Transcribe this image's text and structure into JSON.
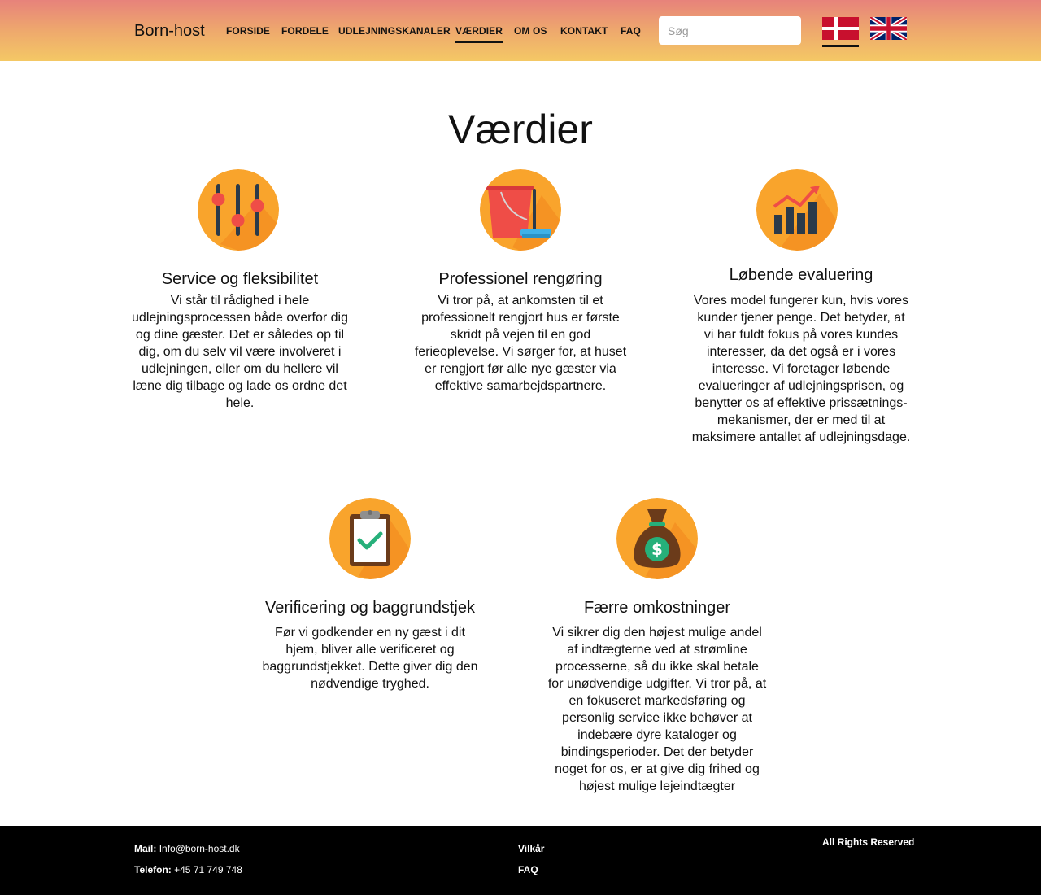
{
  "header": {
    "logo": "Born-host",
    "nav": [
      "FORSIDE",
      "FORDELE",
      "UDLEJNINGSKANALER",
      "VÆRDIER",
      "OM OS",
      "KONTAKT",
      "FAQ"
    ],
    "active_nav": "VÆRDIER",
    "search_placeholder": "Søg",
    "flags": [
      "danish-flag-icon",
      "uk-flag-icon"
    ],
    "active_language": "danish"
  },
  "main": {
    "title": "Værdier",
    "cards": [
      {
        "icon": "sliders-icon",
        "title": "Service og fleksibilitet",
        "text": "Vi står til rådighed i hele udlejningsprocessen både overfor dig og dine gæster. Det er således op til dig, om du selv vil være involveret i udlejningen, eller om du hellere vil læne dig tilbage og lade os ordne det hele."
      },
      {
        "icon": "bucket-mop-icon",
        "title": "Professionel rengøring",
        "text": "Vi tror på, at ankomsten til et professionelt rengjort hus er første skridt på vejen til en god ferieoplevelse. Vi sørger for, at huset er rengjort før alle nye gæster via effektive samarbejdspartnere."
      },
      {
        "icon": "growth-chart-icon",
        "title": "Løbende evaluering",
        "text": "Vores model fungerer kun, hvis vores kunder tjener penge. Det betyder, at vi har fuldt fokus på vores kundes interesser, da det også er i vores interesse. Vi foretager løbende evalueringer af udlejningsprisen, og benytter os af effektive prissætnings-mekanismer, der er med til at maksimere antallet af udlejningsdage."
      },
      {
        "icon": "clipboard-check-icon",
        "title": "Verificering og baggrundstjek",
        "text": "Før vi godkender en ny gæst i dit hjem, bliver alle verificeret og baggrundstjekket. Dette giver dig den nødvendige tryghed."
      },
      {
        "icon": "money-bag-icon",
        "title": "Færre omkostninger",
        "text": "Vi sikrer dig den højest mulige andel af indtægterne ved at strømline processerne, så du ikke skal betale for unødvendige udgifter. Vi tror på, at en fokuseret markedsføring og personlig service ikke behøver at indebære dyre kataloger og bindingsperioder. Det der betyder noget for os, er at give dig frihed og højest mulige lejeindtægter"
      }
    ]
  },
  "footer": {
    "mail_label": "Mail:",
    "mail_value": "Info@born-host.dk",
    "phone_label": "Telefon:",
    "phone_value": "+45 71 749 748",
    "link_terms": "Vilkår",
    "link_faq": "FAQ",
    "rights": "All Rights Reserved"
  },
  "colors": {
    "header_gradient": [
      "#e7827b",
      "#f4c865"
    ],
    "icon_orange": "#f9a42c",
    "footer_bg": "#000000"
  }
}
